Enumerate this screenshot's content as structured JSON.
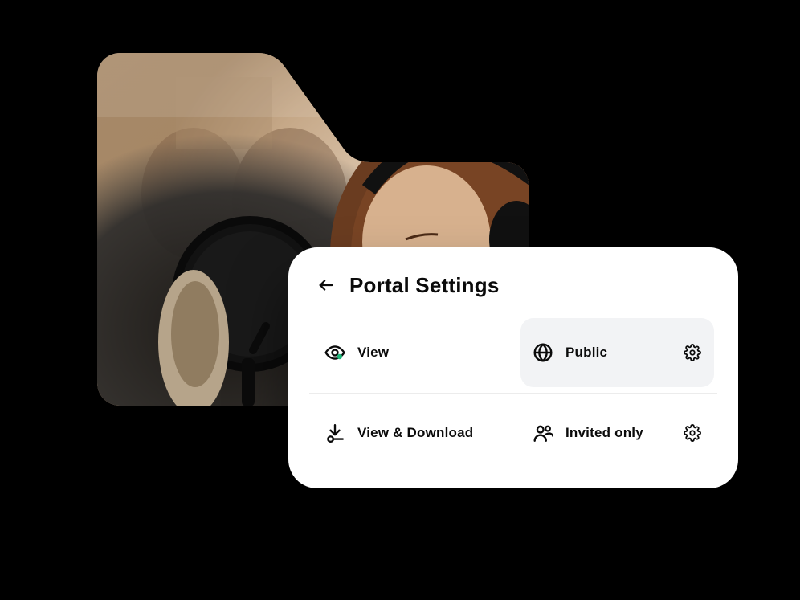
{
  "image_card": {
    "name": "cover-image",
    "alt": "People singing into studio microphones"
  },
  "panel": {
    "title": "Portal Settings",
    "accent_color": "#1db77a",
    "options": {
      "view": {
        "label": "View",
        "selected": false,
        "has_gear": false
      },
      "public": {
        "label": "Public",
        "selected": true,
        "has_gear": true
      },
      "view_download": {
        "label": "View & Download",
        "selected": false,
        "has_gear": false
      },
      "invited_only": {
        "label": "Invited only",
        "selected": false,
        "has_gear": true
      }
    }
  }
}
